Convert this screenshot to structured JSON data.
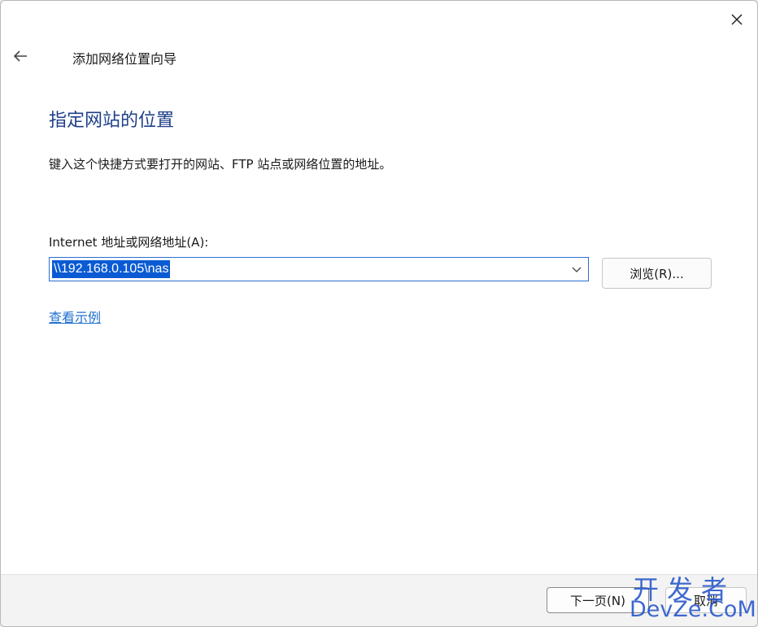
{
  "wizard": {
    "title": "添加网络位置向导",
    "heading": "指定网站的位置",
    "instruction": "键入这个快捷方式要打开的网站、FTP 站点或网络位置的地址。",
    "field_label": "Internet 地址或网络地址(A):",
    "address_value": "\\\\192.168.0.105\\nas",
    "browse_label": "浏览(R)...",
    "example_link": "查看示例"
  },
  "footer": {
    "next_label": "下一页(N)",
    "cancel_label": "取消"
  },
  "watermark": {
    "line1": "开发者",
    "line2": "DevZe.CoM"
  },
  "icons": {
    "close": "close-icon",
    "back": "back-arrow-icon",
    "dropdown": "chevron-down-icon"
  },
  "colors": {
    "heading": "#1e3f88",
    "link": "#1f6fd1",
    "selection": "#0a5bd3",
    "watermark": "#1d4fc8"
  }
}
